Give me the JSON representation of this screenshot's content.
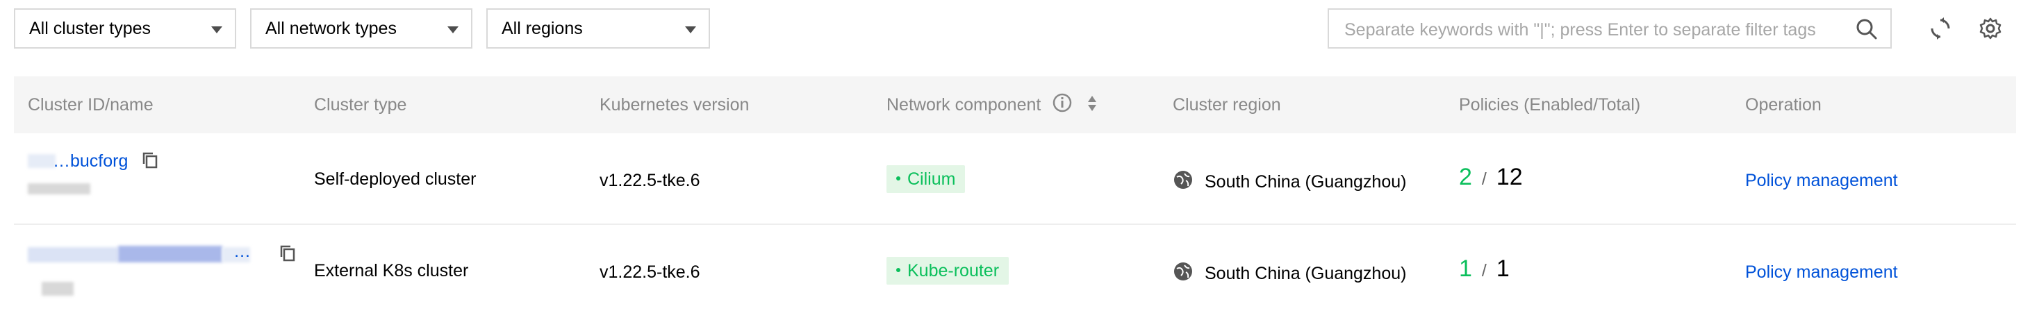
{
  "filters": {
    "cluster_types": "All cluster types",
    "network_types": "All network types",
    "regions": "All regions",
    "search_placeholder": "Separate keywords with \"|\"; press Enter to separate filter tags"
  },
  "table": {
    "headers": {
      "cluster": "Cluster ID/name",
      "type": "Cluster type",
      "version": "Kubernetes version",
      "network": "Network component",
      "region": "Cluster region",
      "policies": "Policies (Enabled/Total)",
      "operation": "Operation"
    },
    "rows": [
      {
        "cluster_id": "…bucforg",
        "cluster_type": "Self-deployed cluster",
        "version": "v1.22.5-tke.6",
        "network": "Cilium",
        "region": "South China (Guangzhou)",
        "enabled": "2",
        "separator": "/",
        "total": "12",
        "operation": "Policy management"
      },
      {
        "cluster_id": "…",
        "cluster_type": "External K8s cluster",
        "version": "v1.22.5-tke.6",
        "network": "Kube-router",
        "region": "South China (Guangzhou)",
        "enabled": "1",
        "separator": "/",
        "total": "1",
        "operation": "Policy management"
      }
    ]
  }
}
